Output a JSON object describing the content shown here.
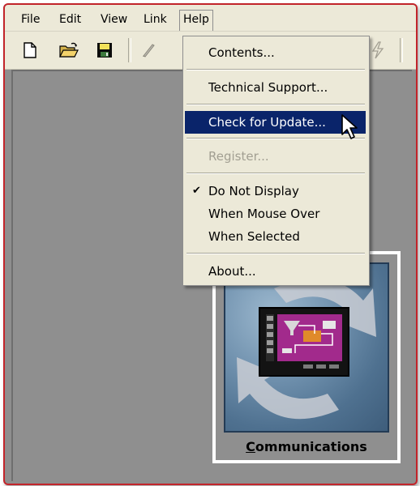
{
  "menubar": {
    "items": [
      "File",
      "Edit",
      "View",
      "Link",
      "Help"
    ]
  },
  "help_menu": {
    "contents": "Contents...",
    "technical_support": "Technical Support...",
    "check_for_update": "Check for Update...",
    "register": "Register...",
    "do_not_display": "Do Not Display",
    "when_mouse_over": "When Mouse Over",
    "when_selected": "When Selected",
    "about": "About..."
  },
  "tile": {
    "label": "Communications",
    "mnemonic_letter": "C",
    "label_rest": "ommunications"
  },
  "colors": {
    "highlight": "#0a246a",
    "frame_border": "#c2242a",
    "menu_bg": "#ece9d8"
  },
  "icons": [
    "new-file-icon",
    "open-folder-icon",
    "save-disk-icon",
    "pen-icon",
    "lightning-icon",
    "checkmark-icon",
    "mouse-cursor-icon"
  ]
}
